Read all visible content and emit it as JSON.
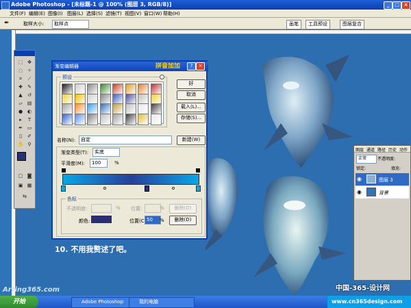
{
  "window": {
    "title": "Adobe Photoshop - [未标题-1 @ 100% (图层 3, RGB/8)]"
  },
  "menubar": {
    "items": [
      "文件(F)",
      "编辑(E)",
      "图像(I)",
      "图层(L)",
      "选择(S)",
      "滤镜(T)",
      "视图(V)",
      "窗口(W)",
      "帮助(H)"
    ]
  },
  "optionsbar": {
    "sample_size_label": "取样大小:",
    "sample_size_value": "取样点",
    "panel_tabs": [
      "画笔",
      "工具预设",
      "图层复合"
    ]
  },
  "gradient_editor": {
    "title": "渐变编辑器",
    "brand": "拼音加加",
    "presets_label": "预设",
    "buttons": {
      "ok": "好",
      "cancel": "取消",
      "load": "载入(L)...",
      "save": "存储(S)...",
      "new": "新建(W)",
      "delete_opacity": "删除(D)",
      "delete_color": "删除(D)"
    },
    "name_label": "名称(N):",
    "name_value": "自定",
    "gradient_type_label": "渐变类型(T):",
    "gradient_type_value": "实底",
    "smoothness_label": "平滑度(M):",
    "smoothness_value": "100",
    "smoothness_unit": "%",
    "stops_label": "色标",
    "opacity_label": "不透明度:",
    "opacity_unit": "%",
    "location_label": "位置:",
    "location_unit": "%",
    "color_label": "颜色:",
    "color_location_label": "位置(C):",
    "color_location_value": "50",
    "color_location_unit": "%",
    "gradient_colors": [
      "#0aa6e6",
      "#2a3f9a",
      "#0aa6e6"
    ],
    "selected_color": "#2a2f7a",
    "preset_swatches": [
      "#1a1a1a",
      "#cfcfcf",
      "#888888",
      "#3a8a2a",
      "#d04020",
      "#e0a020",
      "#e08030",
      "#c03030",
      "#f0d040",
      "#f0c000",
      "#d0d0d0",
      "#888888",
      "#4060c0",
      "#5050a0",
      "#c0c0c0",
      "#f0d030",
      "#a0a0a0",
      "#f09030",
      "#40a0e0",
      "#3070c0",
      "#c0a040",
      "#c0c0c0",
      "#e8e8e8",
      "#404040",
      "#3060d0",
      "#6090f0",
      "#808080",
      "#c0c0c0",
      "#a0a0a0",
      "#404040",
      "#e0c040",
      "#e8e8e8"
    ]
  },
  "layers_panel": {
    "tabs": [
      "图层",
      "通道",
      "路径",
      "历史",
      "动作"
    ],
    "blend_mode": "正常",
    "opacity_label": "不透明度:",
    "lock_label": "锁定:",
    "fill_label": "填充:",
    "layers": [
      {
        "name": "图层 3"
      },
      {
        "name": "背景"
      }
    ]
  },
  "caption": "10. 不用我赘述了吧。",
  "taskbar": {
    "items": [
      "开始",
      "Adobe Photoshop",
      "我的电脑"
    ]
  },
  "watermarks": {
    "left": "Arting365.com",
    "right_top": "中国-365-设计网",
    "right_bottom": "www.cn365design.com"
  },
  "colors": {
    "canvas": "#2f73b8",
    "titlebar": "#0a3fb0",
    "dialog_bg": "#ece9d8"
  }
}
